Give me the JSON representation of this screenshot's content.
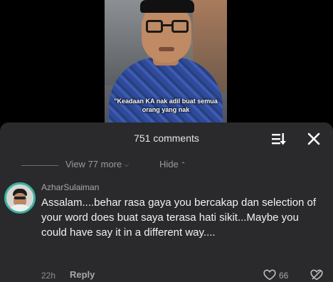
{
  "video": {
    "caption": "\"Keadaan KA nak adil buat semua orang yang nak"
  },
  "comments_header": {
    "count_label": "751 comments",
    "sort_icon": "sort-icon",
    "close_icon": "close-icon"
  },
  "thread_controls": {
    "view_more_label": "View 77 more",
    "hide_label": "Hide"
  },
  "comment": {
    "username": "AzharSulaiman",
    "text": "Assalam....behar rasa gaya you bercakap dan selection of your word does buat saya terasa hati sikit...Maybe you could have say it in a different way....",
    "time": "22h",
    "reply_label": "Reply",
    "like_count": "66"
  },
  "colors": {
    "panel_bg": "#2a2a2c",
    "avatar_ring": "#3bb3a4",
    "muted_text": "#9a9a9e"
  }
}
